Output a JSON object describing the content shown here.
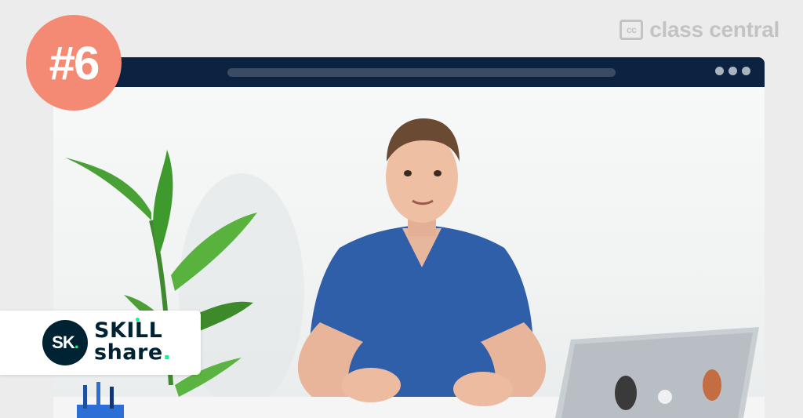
{
  "watermark": {
    "logo_text": "cc",
    "brand": "class central"
  },
  "rank": {
    "label": "#6"
  },
  "provider": {
    "mark": "SK",
    "word_line1": "SKILL",
    "word_line2": "share"
  },
  "browser": {
    "window_controls": [
      "dot",
      "dot",
      "dot"
    ]
  },
  "colors": {
    "badge": "#f58a74",
    "browser_bar": "#0b2240",
    "skillshare_navy": "#002333",
    "skillshare_green": "#00ff84"
  }
}
